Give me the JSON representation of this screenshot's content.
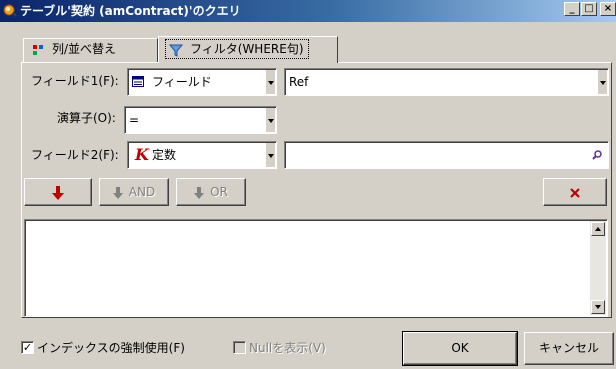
{
  "window": {
    "title": "テーブル'契約 (amContract)'のクエリ",
    "controls": {
      "minimize": "_",
      "maximize": "□",
      "close": "×"
    }
  },
  "tabs": [
    {
      "label": "列/並べ替え",
      "icon": "columns-sort-icon",
      "active": false
    },
    {
      "label": "フィルタ(WHERE句)",
      "icon": "filter-icon",
      "active": true
    }
  ],
  "filter": {
    "field1_label": "フィールド1(F):",
    "field1_type": "フィールド",
    "field1_type_icon": "field-grid-icon",
    "field1_value": "Ref",
    "operator_label": "演算子(O):",
    "operator_value": "=",
    "field2_label": "フィールド2(F):",
    "field2_type": "定数",
    "field2_type_icon": "constant-k-icon",
    "field2_value": ""
  },
  "buttons": {
    "insert_icon": "red-down-arrow-icon",
    "and_label": "AND",
    "or_label": "OR",
    "delete_icon": "red-x-icon",
    "ok_label": "OK",
    "cancel_label": "キャンセル"
  },
  "options": {
    "force_index_label": "インデックスの強制使用(F)",
    "force_index_checked": true,
    "show_null_label": "Nullを表示(V)",
    "show_null_checked": false,
    "show_null_enabled": false
  },
  "colors": {
    "titlebar_start": "#0a246a",
    "titlebar_end": "#a6caf0",
    "accent_red": "#c00000",
    "face": "#d4d0c8"
  }
}
